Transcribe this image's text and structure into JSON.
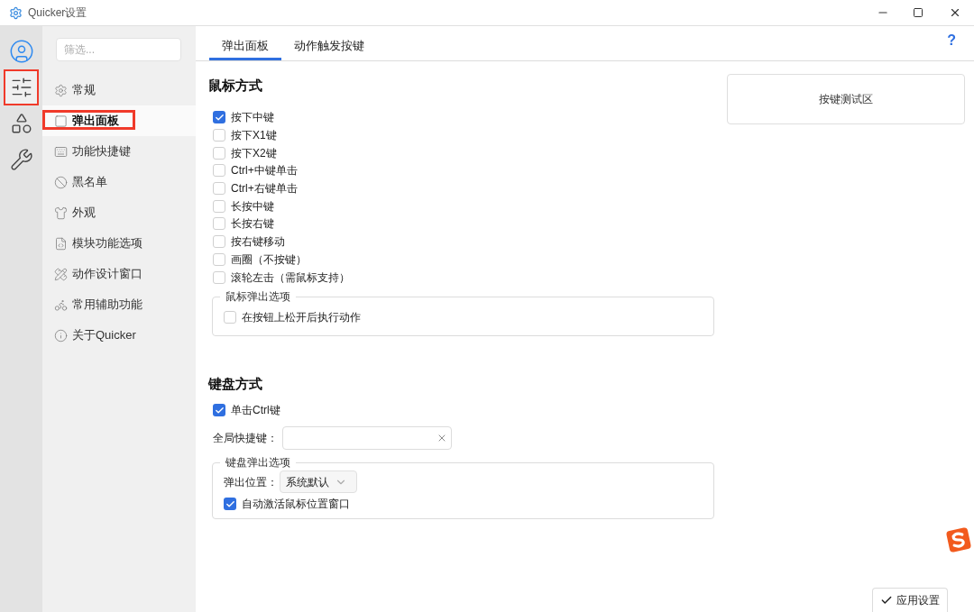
{
  "window": {
    "title": "Quicker设置"
  },
  "rail": [
    {
      "selected": false,
      "highlighted": false
    },
    {
      "selected": true,
      "highlighted": true
    },
    {
      "selected": false,
      "highlighted": false
    },
    {
      "selected": false,
      "highlighted": false
    }
  ],
  "filter": {
    "placeholder": "筛选..."
  },
  "nav": [
    {
      "label": "常规",
      "selected": false,
      "highlighted": false
    },
    {
      "label": "弹出面板",
      "selected": true,
      "highlighted": true
    },
    {
      "label": "功能快捷键",
      "selected": false,
      "highlighted": false
    },
    {
      "label": "黑名单",
      "selected": false,
      "highlighted": false
    },
    {
      "label": "外观",
      "selected": false,
      "highlighted": false
    },
    {
      "label": "模块功能选项",
      "selected": false,
      "highlighted": false
    },
    {
      "label": "动作设计窗口",
      "selected": false,
      "highlighted": false
    },
    {
      "label": "常用辅助功能",
      "selected": false,
      "highlighted": false
    },
    {
      "label": "关于Quicker",
      "selected": false,
      "highlighted": false
    }
  ],
  "tabs": [
    {
      "label": "弹出面板",
      "selected": true
    },
    {
      "label": "动作触发按键",
      "selected": false
    }
  ],
  "help": "?",
  "mouse": {
    "heading": "鼠标方式",
    "options": [
      {
        "label": "按下中键",
        "checked": true
      },
      {
        "label": "按下X1键",
        "checked": false
      },
      {
        "label": "按下X2键",
        "checked": false
      },
      {
        "label": "Ctrl+中键单击",
        "checked": false
      },
      {
        "label": "Ctrl+右键单击",
        "checked": false
      },
      {
        "label": "长按中键",
        "checked": false
      },
      {
        "label": "长按右键",
        "checked": false
      },
      {
        "label": "按右键移动",
        "checked": false
      },
      {
        "label": "画圈（不按键）",
        "checked": false
      },
      {
        "label": "滚轮左击（需鼠标支持）",
        "checked": false
      }
    ],
    "group": {
      "title": "鼠标弹出选项",
      "options": [
        {
          "label": "在按钮上松开后执行动作",
          "checked": false
        }
      ]
    }
  },
  "keyboard": {
    "heading": "键盘方式",
    "options": [
      {
        "label": "单击Ctrl键",
        "checked": true
      }
    ],
    "hotkey_label": "全局快捷键：",
    "group": {
      "title": "键盘弹出选项",
      "position_label": "弹出位置：",
      "position_value": "系统默认",
      "options": [
        {
          "label": "自动激活鼠标位置窗口",
          "checked": true
        }
      ]
    }
  },
  "key_test_area": "按键测试区",
  "apply_button": "应用设置"
}
